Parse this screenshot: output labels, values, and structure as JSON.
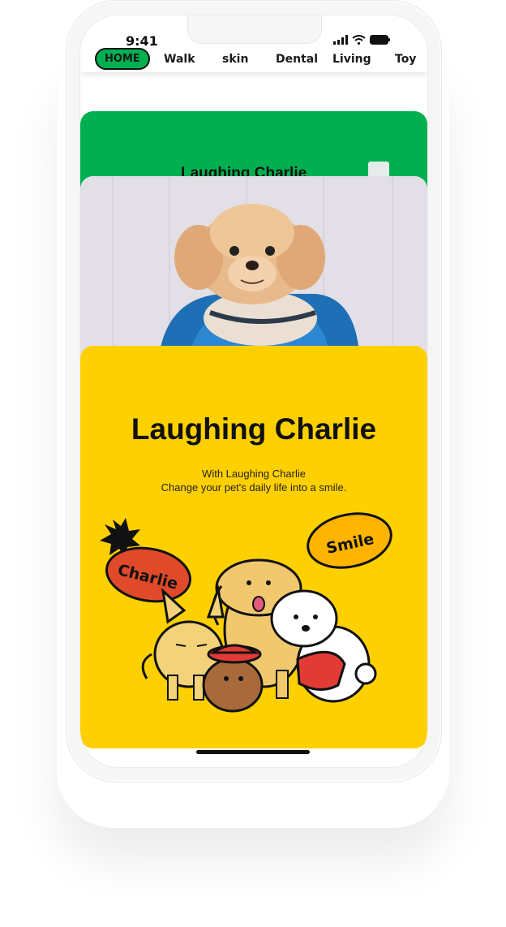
{
  "status_bar": {
    "time": "9:41"
  },
  "nav": {
    "tabs": [
      {
        "label": "HOME",
        "active": true
      },
      {
        "label": "Walk"
      },
      {
        "label": "skin"
      },
      {
        "label": "Dental"
      },
      {
        "label": "Living"
      },
      {
        "label": "Toy"
      }
    ]
  },
  "green_banner": {
    "title": "Laughing Charlie"
  },
  "hero": {
    "title": "Laughing Charlie",
    "line1": "With Laughing Charlie",
    "line2": "Change your pet's daily life into a smile.",
    "badge_left": "Charlie",
    "badge_right": "Smile"
  },
  "colors": {
    "accent_green": "#00b050",
    "yellow": "#ffd000",
    "badge_red": "#e04a2a",
    "badge_orange": "#ffb400"
  },
  "icons": [
    "signal-icon",
    "wifi-icon",
    "battery-icon"
  ]
}
